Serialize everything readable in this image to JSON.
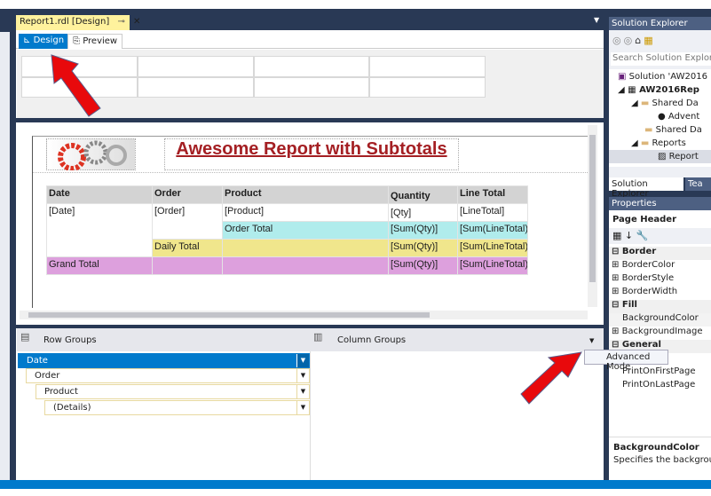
{
  "document_tab": {
    "title": "Report1.rdl [Design]",
    "pin_icon": "pin-icon",
    "close_icon": "close-icon"
  },
  "view_tabs": [
    {
      "label": "Design",
      "active": true,
      "icon": "design-ruler-icon"
    },
    {
      "label": "Preview",
      "active": false,
      "icon": "preview-icon"
    }
  ],
  "report": {
    "title": "Awesome Report with Subtotals",
    "title_color": "#a41f23",
    "table": {
      "headers": [
        "Date",
        "Order",
        "Product",
        "Quantity",
        "Line Total"
      ],
      "rows": [
        [
          "[Date]",
          "[Order]",
          "[Product]",
          "[Qty]",
          "[LineTotal]"
        ],
        [
          "",
          "",
          "Order Total",
          "[Sum(Qty)]",
          "[Sum(LineTotal)"
        ],
        [
          "",
          "Daily Total",
          "",
          "[Sum(Qty)]",
          "[Sum(LineTotal)"
        ],
        [
          "Grand Total",
          "",
          "",
          "[Sum(Qty)]",
          "[Sum(LineTotal)"
        ]
      ],
      "colors": {
        "header": "#d3d3d3",
        "order_total": "#b0ecec",
        "daily_total": "#f0e68c",
        "grand_total": "#dda0dd"
      }
    }
  },
  "grouping": {
    "row_groups_label": "Row Groups",
    "column_groups_label": "Column Groups",
    "row_groups": [
      {
        "label": "Date",
        "selected": true
      },
      {
        "label": "Order"
      },
      {
        "label": "Product"
      },
      {
        "label": "(Details)"
      }
    ]
  },
  "context_menu": {
    "item": "Advanced Mode"
  },
  "solution_explorer": {
    "title": "Solution Explorer",
    "search_placeholder": "Search Solution Explor",
    "tree": [
      "Solution 'AW2016",
      "AW2016Rep",
      "Shared Da",
      "Advent",
      "Shared Da",
      "Reports",
      "Report"
    ],
    "tabs": [
      "Solution Explorer",
      "Tea"
    ]
  },
  "properties": {
    "title": "Properties",
    "object": "Page Header",
    "items": [
      {
        "label": "Border",
        "category": true
      },
      {
        "label": "BorderColor",
        "expandable": true
      },
      {
        "label": "BorderStyle",
        "expandable": true
      },
      {
        "label": "BorderWidth",
        "expandable": true
      },
      {
        "label": "Fill",
        "category": true
      },
      {
        "label": "BackgroundColor"
      },
      {
        "label": "BackgroundImage",
        "expandable": true
      },
      {
        "label": "General",
        "category": true
      },
      {
        "label": "PrintOnFirstPage"
      },
      {
        "label": "PrintOnLastPage"
      }
    ],
    "description_title": "BackgroundColor",
    "description": "Specifies the backgrou"
  },
  "accent": "#007acc"
}
